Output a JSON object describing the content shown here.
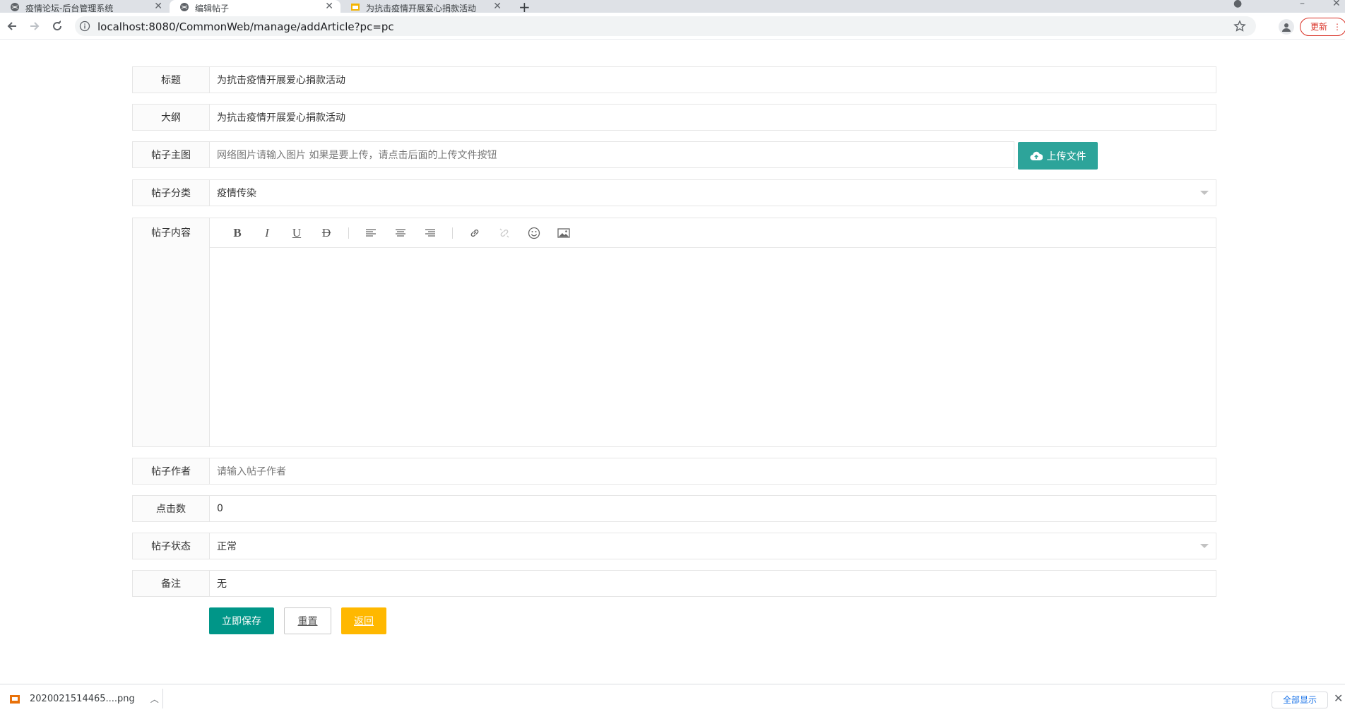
{
  "browser": {
    "tabs": [
      {
        "title": "疫情论坛-后台管理系统",
        "icon": "globe-icon"
      },
      {
        "title": "编辑帖子",
        "icon": "globe-icon"
      },
      {
        "title": "为抗击疫情开展爱心捐款活动",
        "icon": "image-file-icon"
      }
    ],
    "url": "localhost:8080/CommonWeb/manage/addArticle?pc=pc",
    "update_label": "更新"
  },
  "form": {
    "title": {
      "label": "标题",
      "value": "为抗击疫情开展爱心捐款活动"
    },
    "outline": {
      "label": "大纲",
      "value": "为抗击疫情开展爱心捐款活动"
    },
    "main_image": {
      "label": "帖子主图",
      "placeholder": "网络图片请输入图片 如果是要上传，请点击后面的上传文件按钮",
      "upload_label": "上传文件"
    },
    "category": {
      "label": "帖子分类",
      "value": "疫情传染"
    },
    "content": {
      "label": "帖子内容",
      "toolbar": [
        "bold",
        "italic",
        "underline",
        "strikethrough",
        "align-left",
        "align-center",
        "align-right",
        "link",
        "unlink",
        "emoji",
        "image"
      ]
    },
    "author": {
      "label": "帖子作者",
      "placeholder": "请输入帖子作者"
    },
    "clicks": {
      "label": "点击数",
      "value": "0"
    },
    "status": {
      "label": "帖子状态",
      "value": "正常"
    },
    "remark": {
      "label": "备注",
      "value": "无"
    },
    "buttons": {
      "save": "立即保存",
      "reset": "重置",
      "back": "返回"
    }
  },
  "colors": {
    "save": "#009688",
    "back": "#ffb800",
    "upload": "#2da49a"
  },
  "downloads": {
    "file": "2020021514465....png",
    "show_all": "全部显示"
  }
}
